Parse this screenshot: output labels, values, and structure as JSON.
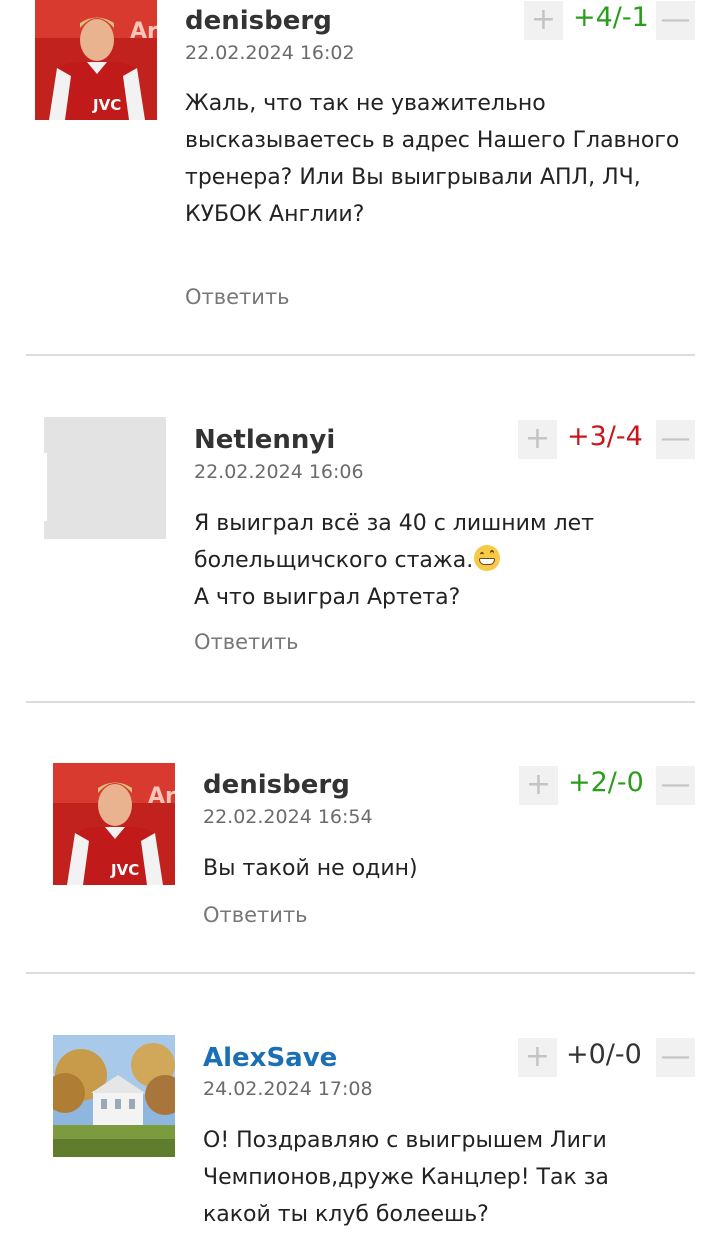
{
  "reply_label": "Ответить",
  "comments": [
    {
      "author": "denisberg",
      "date": "22.02.2024 16:02",
      "score": "+4/-1",
      "text": [
        "Жаль, что так не уважительно высказываетесь в адрес Нашего Главного тренера? Или Вы выигрывали АПЛ, ЛЧ, КУБОК Англии?"
      ]
    },
    {
      "author": "Netlennyi",
      "date": "22.02.2024 16:06",
      "score": "+3/-4",
      "text": [
        "Я выиграл всё за 40 с лишним лет болельщичского стажа.",
        "А что выиграл Артета?"
      ]
    },
    {
      "author": "denisberg",
      "date": "22.02.2024 16:54",
      "score": "+2/-0",
      "text": [
        "Вы такой не один)"
      ]
    },
    {
      "author": "AlexSave",
      "date": "24.02.2024 17:08",
      "score": "+0/-0",
      "text": [
        "О! Поздравляю с выигрышем Лиги Чемпионов,друже Канцлер! Так за какой ты клуб болеешь?"
      ]
    }
  ],
  "colors": {
    "positive": "#2a9d1b",
    "negative": "#c8161d",
    "neutral": "#333333",
    "author_link": "#1a6fb5"
  },
  "icons": {
    "upvote": "+",
    "downvote": "—"
  }
}
